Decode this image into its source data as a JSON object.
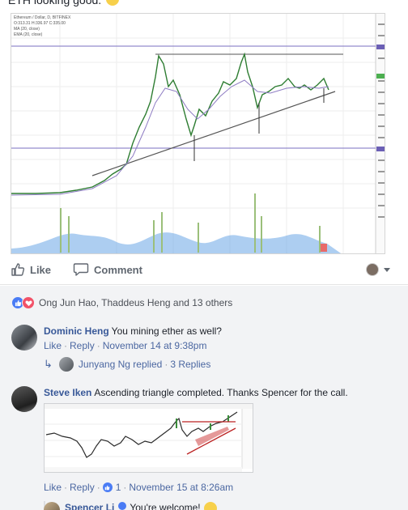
{
  "post": {
    "text": "ETH looking good.",
    "emoji_icon": "smile-emoji"
  },
  "chart": {
    "legend_title": "Ethereum / Dollar, D, BITFINEX",
    "legend_ohlc": "O:313.31 H:336.97 C:335.00",
    "legend_ma1": "MA (20, close)",
    "legend_ma2": "EMA (20, close)"
  },
  "actions": {
    "like_label": "Like",
    "comment_label": "Comment",
    "like_icon": "thumbs-up-icon",
    "comment_icon": "speech-bubble-icon"
  },
  "reactions": {
    "summary": "Ong Jun Hao, Thaddeus Heng and 13 others",
    "like_color": "#4a7cf5",
    "love_color": "#f25268"
  },
  "comments": [
    {
      "author": "Dominic Heng",
      "text": "You mining ether as well?",
      "like": "Like",
      "reply": "Reply",
      "time": "November 14 at 9:38pm",
      "replies_author": "Junyang Ng replied",
      "replies_count": "3 Replies"
    },
    {
      "author": "Steve Iken",
      "text": "Ascending triangle completed. Thanks Spencer for the call.",
      "like": "Like",
      "reply": "Reply",
      "likes": "1",
      "time": "November 15 at 8:26am"
    }
  ],
  "nested_reply": {
    "author": "Spencer Li",
    "text": "You're welcome!"
  }
}
